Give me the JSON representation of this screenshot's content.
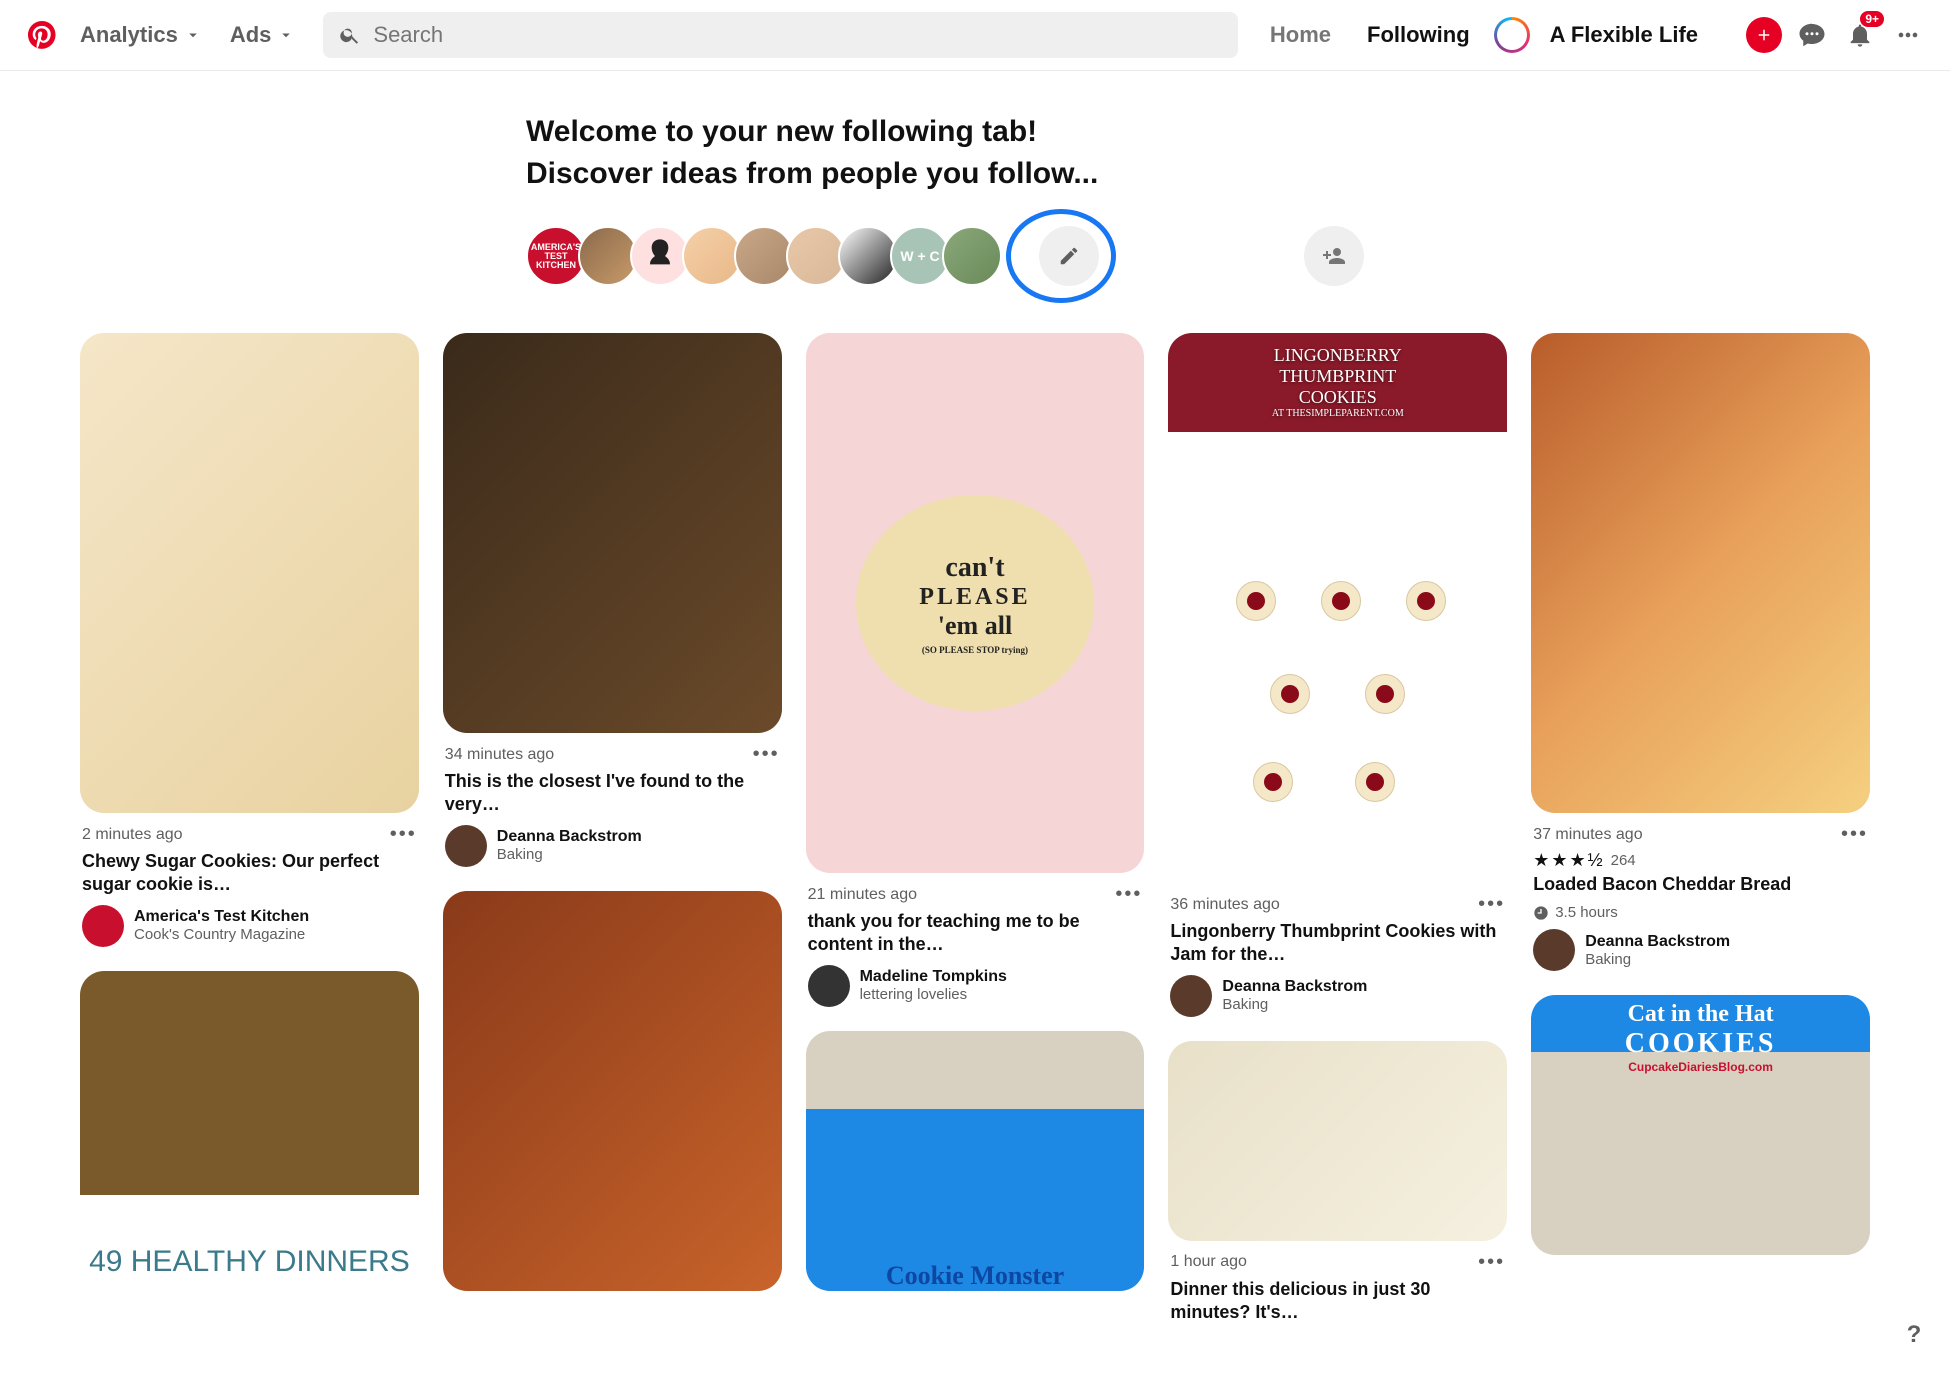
{
  "header": {
    "analytics": "Analytics",
    "ads": "Ads",
    "search_placeholder": "Search",
    "home": "Home",
    "following": "Following",
    "user": "A Flexible Life",
    "notification_badge": "9+"
  },
  "welcome": {
    "line1": "Welcome to your new following tab!",
    "line2": "Discover ideas from people you follow...",
    "atk_label": "AMERICA'S TEST KITCHEN",
    "wc_label": "W + C"
  },
  "pins": [
    {
      "time": "2 minutes ago",
      "title": "Chewy Sugar Cookies: Our perfect sugar cookie is…",
      "author": "America's Test Kitchen",
      "sub": "Cook's Country Magazine"
    },
    {
      "overlay_label": "49 HEALTHY DINNERS"
    },
    {
      "time": "34 minutes ago",
      "title": "This is the closest I've found to the very…",
      "author": "Deanna Backstrom",
      "sub": "Baking"
    },
    {
      "time": "21 minutes ago",
      "title": "thank you for teaching me to be content in the…",
      "author": "Madeline Tompkins",
      "sub": "lettering lovelies",
      "quote_l1": "can't",
      "quote_l2": "PLEASE",
      "quote_l3": "'em all",
      "quote_sub": "(SO PLEASE STOP trying)"
    },
    {
      "overlay_label": "Cookie Monster"
    },
    {
      "time": "36 minutes ago",
      "title": "Lingonberry Thumbprint Cookies with Jam for the…",
      "author": "Deanna Backstrom",
      "sub": "Baking",
      "overlay_l1": "LINGONBERRY",
      "overlay_l2": "THUMBPRINT",
      "overlay_l3": "COOKIES",
      "overlay_l4": "AT THESIMPLEPARENT.COM"
    },
    {
      "time": "1 hour ago",
      "title": "Dinner this delicious in just 30 minutes? It's…"
    },
    {
      "time": "37 minutes ago",
      "title": "Loaded Bacon Cheddar Bread",
      "author": "Deanna Backstrom",
      "sub": "Baking",
      "rating_stars": "★★★½",
      "rating_count": "264",
      "duration": "3.5 hours"
    },
    {
      "cat_l1": "Cat in the Hat",
      "cat_l2": "COOKIES",
      "cat_l3": "CupcakeDiariesBlog.com"
    }
  ],
  "help": "?"
}
